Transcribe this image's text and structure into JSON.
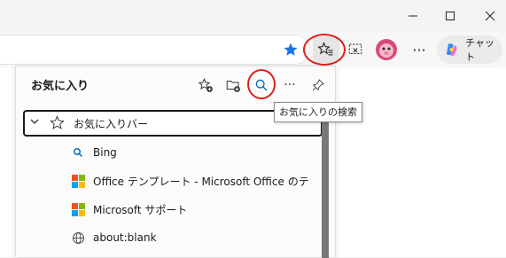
{
  "window": {
    "minimize_icon": "minimize-icon",
    "maximize_icon": "maximize-icon",
    "close_icon": "close-icon"
  },
  "toolbar": {
    "chat_label": "チャット"
  },
  "favorites_panel": {
    "title": "お気に入り",
    "tooltip": "お気に入りの検索",
    "folder": {
      "label": "お気に入りバー"
    },
    "items": [
      {
        "label": "Bing",
        "icon": "bing-search-icon"
      },
      {
        "label": "Office テンプレート - Microsoft Office のテンプレート",
        "icon": "microsoft-logo-icon"
      },
      {
        "label": "Microsoft サポート",
        "icon": "microsoft-logo-icon"
      },
      {
        "label": "about:blank",
        "icon": "globe-icon"
      }
    ]
  },
  "colors": {
    "accent": "#0067c0",
    "highlight_ring": "#e0201b",
    "star_blue": "#1a73e8"
  }
}
